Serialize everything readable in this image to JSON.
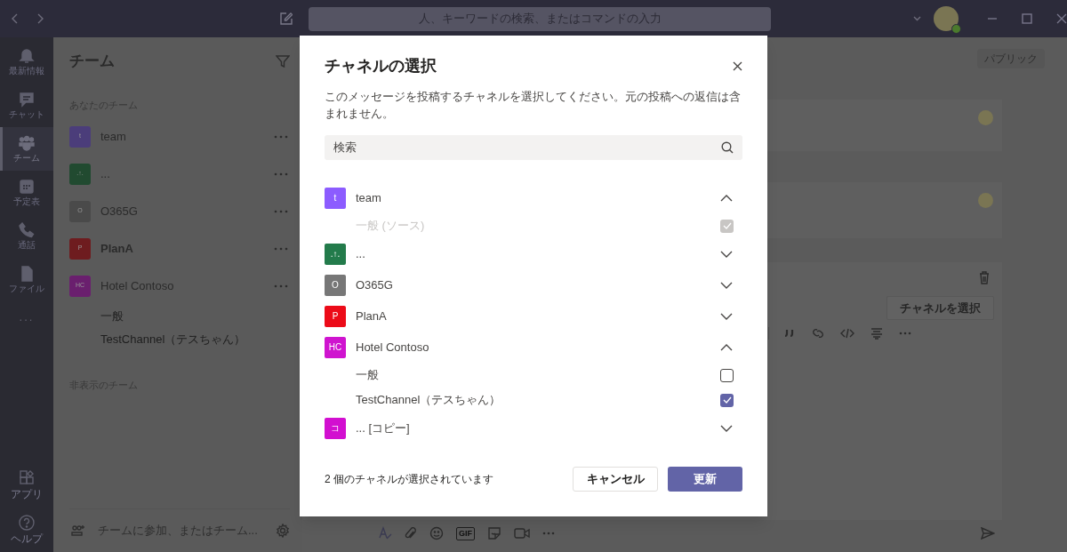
{
  "title_bar": {
    "search_placeholder": "人、キーワードの検索、またはコマンドの入力"
  },
  "rail": {
    "items": [
      {
        "label": "最新情報",
        "selected": false
      },
      {
        "label": "チャット",
        "selected": false
      },
      {
        "label": "チーム",
        "selected": true
      },
      {
        "label": "予定表",
        "selected": false
      },
      {
        "label": "通話",
        "selected": false
      },
      {
        "label": "ファイル",
        "selected": false
      }
    ],
    "more": "...",
    "bottom": [
      {
        "label": "アプリ"
      },
      {
        "label": "ヘルプ"
      }
    ]
  },
  "teams_panel": {
    "title": "チーム",
    "section": "あなたのチーム",
    "teams": [
      {
        "initials": "t",
        "name": "team",
        "color": "#4b3d7a",
        "bold": false
      },
      {
        "initials": ".↑.",
        "name": "...",
        "color": "#214a30",
        "bold": false
      },
      {
        "initials": "O",
        "name": "O365G",
        "color": "#4a4a4a",
        "bold": false
      },
      {
        "initials": "P",
        "name": "PlanA",
        "color": "#6e1c1f",
        "bold": true
      },
      {
        "initials": "HC",
        "name": "Hotel Contoso",
        "color": "#6a1f6e",
        "bold": false,
        "channels": [
          "一般",
          "TestChannel（テスちゃん）"
        ]
      }
    ],
    "hidden_section": "非表示のチーム",
    "join": "チームに参加、またはチーム..."
  },
  "main": {
    "badge": "パブリック",
    "select_button": "チャネルを選択",
    "gif_label": "GIF"
  },
  "dialog": {
    "title": "チャネルの選択",
    "description": "このメッセージを投稿するチャネルを選択してください。元の投稿への返信は含まれません。",
    "search_placeholder": "検索",
    "teams": [
      {
        "initials": "t",
        "name": "team",
        "color": "#8c5cff",
        "expanded": true,
        "channels": [
          {
            "name": "一般 (ソース)",
            "checked": true,
            "disabled": true
          }
        ]
      },
      {
        "initials": ".↑.",
        "name": "...",
        "color": "#237b4b",
        "expanded": false
      },
      {
        "initials": "O",
        "name": "O365G",
        "color": "#777777",
        "expanded": false
      },
      {
        "initials": "P",
        "name": "PlanA",
        "color": "#ec0b18",
        "expanded": false
      },
      {
        "initials": "HC",
        "name": "Hotel Contoso",
        "color": "#cf14cf",
        "expanded": true,
        "channels": [
          {
            "name": "一般",
            "checked": false,
            "disabled": false
          },
          {
            "name": "TestChannel（テスちゃん）",
            "checked": true,
            "disabled": false
          }
        ]
      },
      {
        "initials": "コ",
        "name": "... [コピー]",
        "color": "#d20fd0",
        "expanded": false
      }
    ],
    "status": "2 個のチャネルが選択されています",
    "cancel": "キャンセル",
    "update": "更新"
  }
}
